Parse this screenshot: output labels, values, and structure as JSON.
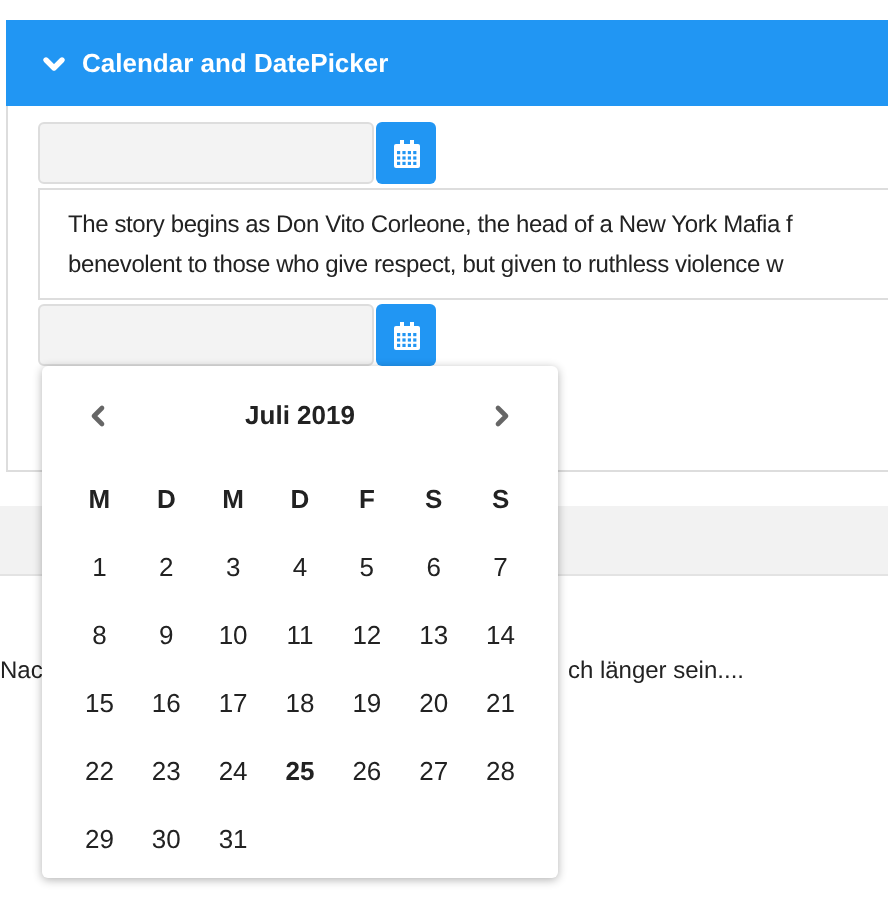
{
  "panel": {
    "title": "Calendar and DatePicker",
    "expanded": true
  },
  "date_pickers": [
    {
      "open": false
    },
    {
      "open": true
    }
  ],
  "paragraph_lines": [
    "The story begins as Don Vito Corleone, the head of a New York Mafia f",
    "benevolent to those who give respect, but given to ruthless violence w"
  ],
  "calendar": {
    "month": "Juli 2019",
    "weekdays": [
      "M",
      "D",
      "M",
      "D",
      "F",
      "S",
      "S"
    ],
    "days": [
      {
        "label": "1",
        "today": false
      },
      {
        "label": "2",
        "today": false
      },
      {
        "label": "3",
        "today": false
      },
      {
        "label": "4",
        "today": false
      },
      {
        "label": "5",
        "today": false
      },
      {
        "label": "6",
        "today": false
      },
      {
        "label": "7",
        "today": false
      },
      {
        "label": "8",
        "today": false
      },
      {
        "label": "9",
        "today": false
      },
      {
        "label": "10",
        "today": false
      },
      {
        "label": "11",
        "today": false
      },
      {
        "label": "12",
        "today": false
      },
      {
        "label": "13",
        "today": false
      },
      {
        "label": "14",
        "today": false
      },
      {
        "label": "15",
        "today": false
      },
      {
        "label": "16",
        "today": false
      },
      {
        "label": "17",
        "today": false
      },
      {
        "label": "18",
        "today": false
      },
      {
        "label": "19",
        "today": false
      },
      {
        "label": "20",
        "today": false
      },
      {
        "label": "21",
        "today": false
      },
      {
        "label": "22",
        "today": false
      },
      {
        "label": "23",
        "today": false
      },
      {
        "label": "24",
        "today": false
      },
      {
        "label": "25",
        "today": true
      },
      {
        "label": "26",
        "today": false
      },
      {
        "label": "27",
        "today": false
      },
      {
        "label": "28",
        "today": false
      },
      {
        "label": "29",
        "today": false
      },
      {
        "label": "30",
        "today": false
      },
      {
        "label": "31",
        "today": false
      }
    ]
  },
  "below_text": {
    "left": "Nac",
    "right": "ch länger sein...."
  }
}
